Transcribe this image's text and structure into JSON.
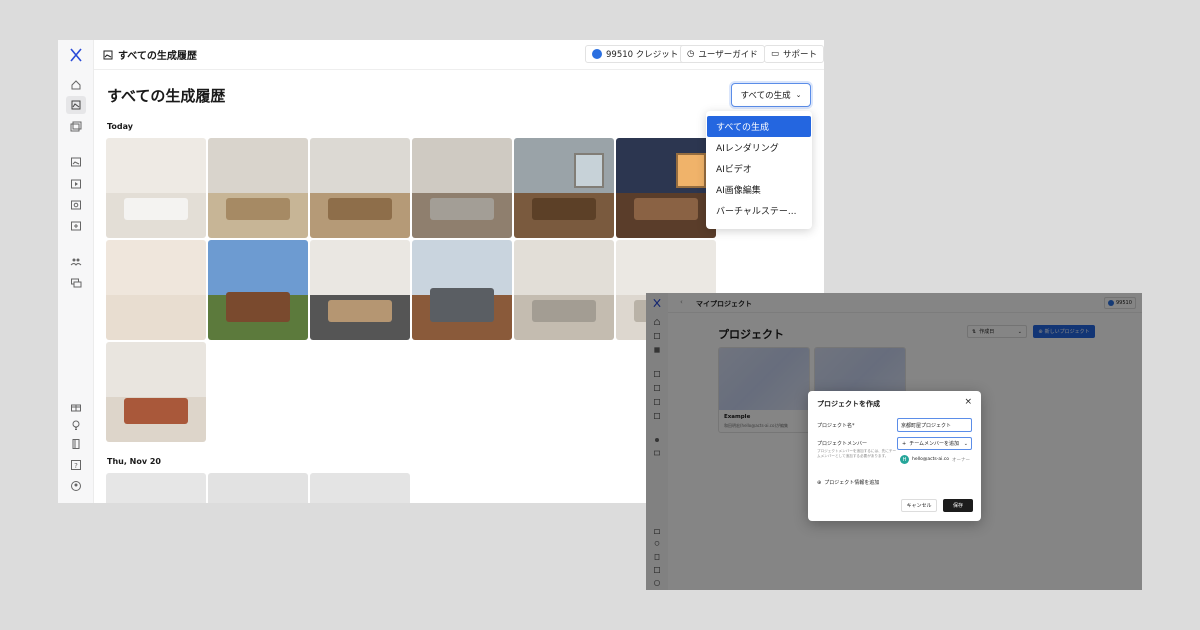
{
  "main_window": {
    "topbar": {
      "title": "すべての生成履歴",
      "credits": "99510 クレジット",
      "guide": "ユーザーガイド",
      "support": "サポート"
    },
    "heading": "すべての生成履歴",
    "filter": {
      "label": "すべての生成"
    },
    "sections": [
      {
        "label": "Today"
      },
      {
        "label": "Thu, Nov 20"
      }
    ],
    "filter_menu": {
      "items": [
        "すべての生成",
        "AIレンダリング",
        "AIビデオ",
        "AI画像編集",
        "バーチャルステー..."
      ],
      "selected_index": 0
    },
    "sidebar_icons": [
      "home-icon",
      "gallery-icon",
      "projects-icon",
      "image-icon",
      "video-icon",
      "edit-icon",
      "staging-icon",
      "team-icon",
      "chat-icon",
      "gift-icon",
      "bulb-icon",
      "book-icon",
      "help-icon",
      "account-icon"
    ],
    "accent_color": "#2466e0"
  },
  "project_window": {
    "topbar": {
      "title": "マイプロジェクト",
      "credits": "99510"
    },
    "heading": "プロジェクト",
    "sort": {
      "label": "作成日"
    },
    "new_project_button": "新しいプロジェクト",
    "cards": [
      {
        "title": "Example",
        "subtitle": "和田明宏(hello@acts-ai.co)が編集"
      },
      {
        "title": "",
        "subtitle": ""
      }
    ],
    "dialog": {
      "title": "プロジェクトを作成",
      "name_label": "プロジェクト名*",
      "name_value": "京都町屋プロジェクト",
      "members_label": "プロジェクトメンバー",
      "members_hint": "プロジェクトメンバーを追加するには、先にチームメンバーとして追加する必要があります。",
      "add_member_button": "チームメンバーを追加",
      "member": {
        "initial": "H",
        "email": "hello@acts-ai.co",
        "role": "オーナー"
      },
      "add_info": "プロジェクト情報を追加",
      "cancel": "キャンセル",
      "save": "保存"
    }
  }
}
